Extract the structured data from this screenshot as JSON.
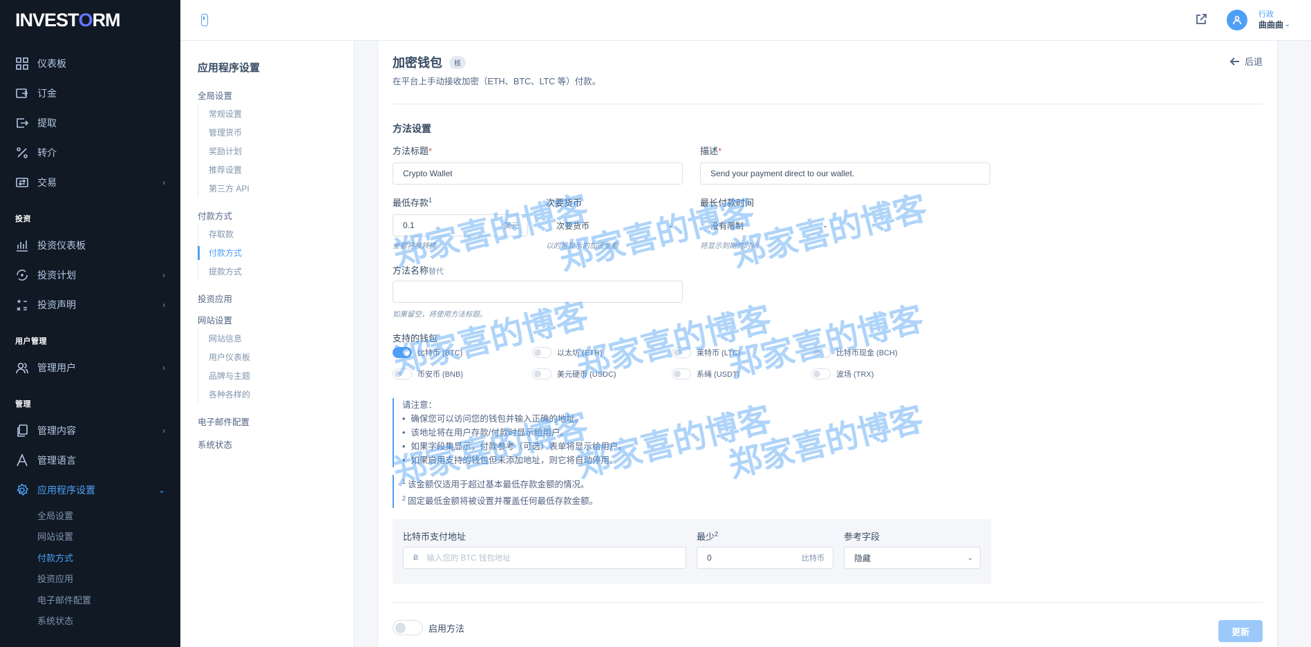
{
  "brand": {
    "logo_pre": "INVEST",
    "logo_o": "O",
    "logo_post": "RM"
  },
  "sidebar": {
    "items_top": [
      {
        "label": "仪表板",
        "icon": "dashboard-icon"
      },
      {
        "label": "订金",
        "icon": "deposit-icon"
      },
      {
        "label": "提取",
        "icon": "withdraw-icon"
      },
      {
        "label": "转介",
        "icon": "percent-icon"
      },
      {
        "label": "交易",
        "icon": "exchange-icon"
      }
    ],
    "head_invest": "投资",
    "items_invest": [
      {
        "label": "投资仪表板"
      },
      {
        "label": "投资计划"
      },
      {
        "label": "投资声明"
      }
    ],
    "head_users": "用户管理",
    "manage_users": "管理用户",
    "head_manage": "管理",
    "manage_content": "管理内容",
    "manage_language": "管理语言",
    "app_settings": "应用程序设置",
    "sub_items": [
      "全局设置",
      "网站设置",
      "付款方式",
      "投资应用",
      "电子邮件配置",
      "系统状态"
    ]
  },
  "topbar": {
    "user_role": "行政",
    "user_name": "曲曲曲"
  },
  "settings_nav": {
    "title": "应用程序设置",
    "group_global": "全局设置",
    "global_items": [
      "常规设置",
      "管理货币",
      "奖励计划",
      "推荐设置",
      "第三方 API"
    ],
    "group_payment": "付款方式",
    "payment_items": [
      "存取款",
      "付款方式",
      "提款方式"
    ],
    "group_invest": "投资应用",
    "group_site": "网站设置",
    "site_items": [
      "网站信息",
      "用户仪表板",
      "品牌与主题",
      "各种各样的"
    ],
    "group_email": "电子邮件配置",
    "group_status": "系统状态"
  },
  "page": {
    "title": "加密钱包",
    "badge": "核",
    "desc": "在平台上手动接收加密（ETH、BTC、LTC 等）付款。",
    "back": "后退",
    "section_title": "方法设置",
    "method_title_label": "方法标题",
    "method_title_value": "Crypto Wallet",
    "desc_label": "描述",
    "desc_value": "Send your payment direct to our wallet.",
    "min_deposit_label": "最低存款",
    "min_deposit_value": "0.1",
    "min_deposit_suffix": "美元",
    "min_deposit_hint": "金额将被转换",
    "secondary_currency_label": "次要货币",
    "secondary_currency_value": "次要货币",
    "secondary_currency_hint": "以的将显示的加密金额",
    "max_time_label": "最长付款时间",
    "max_time_value": "没有限制",
    "max_time_hint": "将显示到期的时间",
    "method_name_label": "方法名称",
    "method_name_opt": "替代",
    "method_name_hint": "如果留空，将使用方法标题。",
    "wallets_label": "支持的钱包",
    "wallets": [
      {
        "label": "比特币 (BTC)",
        "on": true
      },
      {
        "label": "以太坊 (ETH)",
        "on": false
      },
      {
        "label": "莱特币 (LTC)",
        "on": false
      },
      {
        "label": "比特币现金 (BCH)",
        "on": false
      },
      {
        "label": "币安币 (BNB)",
        "on": false
      },
      {
        "label": "美元硬币 (USDC)",
        "on": false
      },
      {
        "label": "系绳 (USDT)",
        "on": false
      },
      {
        "label": "波场 (TRX)",
        "on": false
      }
    ],
    "note_title": "请注意：",
    "notes": [
      "确保您可以访问您的钱包并输入正确的地址。",
      "该地址将在用户存款/付款时显示给用户。",
      "如果字段集显示，付款参考（可选）表单将显示给用户。",
      "如果启用支持的钱包但未添加地址，则它将自动停用。"
    ],
    "footnote1": "该金额仅适用于超过基本最低存款金额的情况。",
    "footnote2": "固定最低金额将被设置并覆盖任何最低存款金额。",
    "addr_label": "比特币支付地址",
    "addr_placeholder": "输入您的 BTC 钱包地址",
    "addr_prefix": "Ƀ",
    "min_label": "最少",
    "min_value": "0",
    "min_suffix": "比特币",
    "ref_label": "参考字段",
    "ref_value": "隐藏",
    "enable_label": "启用方法",
    "update_btn": "更新"
  },
  "watermark": "郑家喜的博客"
}
